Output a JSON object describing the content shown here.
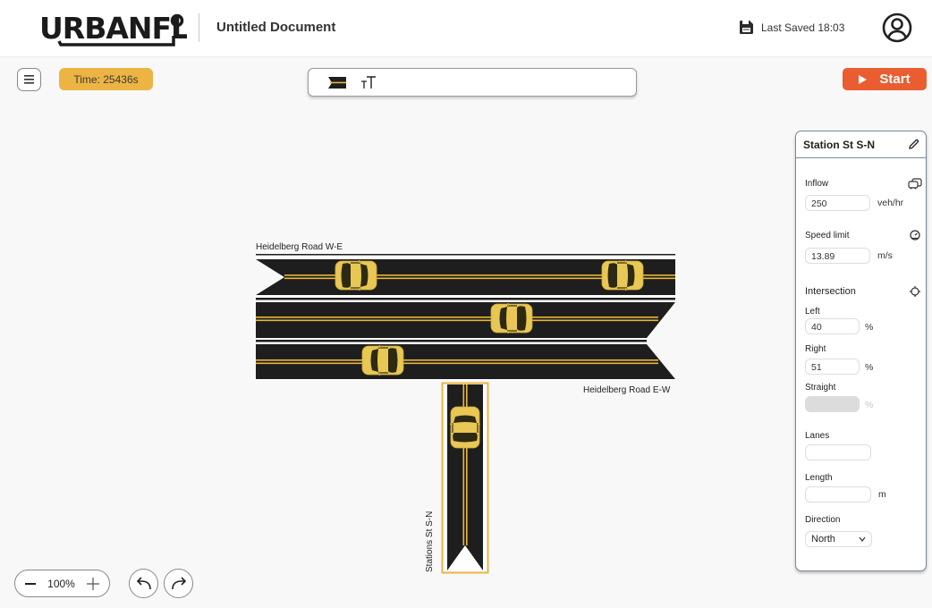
{
  "header": {
    "logo": "URBANFLO",
    "document_title": "Untitled Document",
    "last_saved": "Last Saved 18:03",
    "icons": {
      "save": "floppy-disk-icon",
      "account": "user-circle-icon"
    }
  },
  "toolbar": {
    "menu_icon": "hamburger-icon",
    "time_label": "Time:  25436s",
    "tools": [
      {
        "name": "road-tool",
        "icon": "road-icon"
      },
      {
        "name": "text-tool",
        "label": "ᴛT"
      }
    ],
    "start_label": "Start",
    "start_color": "#ea5d30",
    "time_color": "#ecb443"
  },
  "canvas": {
    "roads": [
      {
        "label": "Heidelberg Road W-E",
        "direction": "W-E"
      },
      {
        "label": "Heidelberg Road E-W",
        "direction": "E-W"
      },
      {
        "label": "Stations St S-N",
        "direction": "S-N",
        "selected": true
      }
    ],
    "colors": {
      "asphalt": "#1f1e1e",
      "lane_line": "#e9b83a",
      "edge_line": "#ffffff",
      "car": "#e8c754",
      "selection": "#ecb443"
    }
  },
  "panel": {
    "title": "Station St S-N",
    "inflow": {
      "label": "Inflow",
      "value": "250",
      "unit": "veh/hr"
    },
    "speed_limit": {
      "label": "Speed limit",
      "value": "13.89",
      "unit": "m/s"
    },
    "intersection": {
      "label": "Intersection",
      "left": {
        "label": "Left",
        "value": "40",
        "unit": "%"
      },
      "right": {
        "label": "Right",
        "value": "51",
        "unit": "%"
      },
      "straight": {
        "label": "Straight",
        "value": "",
        "unit": "%"
      }
    },
    "lanes": {
      "label": "Lanes",
      "value": ""
    },
    "length": {
      "label": "Length",
      "value": "",
      "unit": "m"
    },
    "direction": {
      "label": "Direction",
      "value": "North"
    }
  },
  "footer": {
    "zoom": "100%"
  }
}
